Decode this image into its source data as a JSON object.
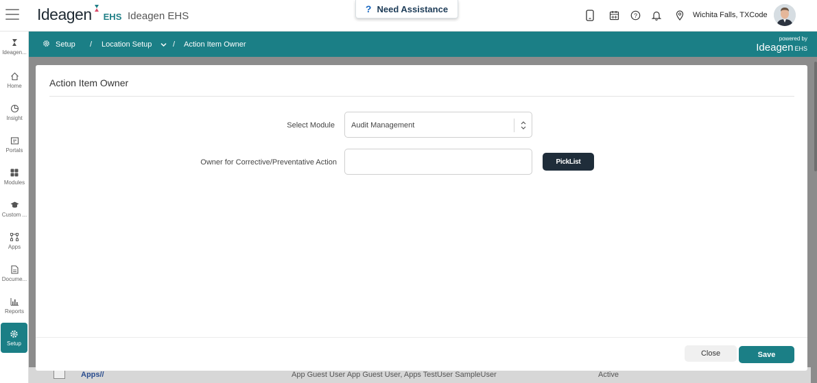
{
  "header": {
    "logo_word": "Ideagen",
    "logo_suffix": "EHS",
    "app_title": "Ideagen EHS",
    "assist_label": "Need Assistance",
    "location": "Wichita Falls, TXCode"
  },
  "sidebar": {
    "items": [
      {
        "label": "Ideagen...",
        "icon": "ideagen-icon"
      },
      {
        "label": "Home",
        "icon": "home-icon"
      },
      {
        "label": "Insight",
        "icon": "pie-chart-icon"
      },
      {
        "label": "Portals",
        "icon": "portal-icon"
      },
      {
        "label": "Modules",
        "icon": "grid-icon"
      },
      {
        "label": "Custom ...",
        "icon": "graduation-cap-icon"
      },
      {
        "label": "Apps",
        "icon": "apps-icon"
      },
      {
        "label": "Docume...",
        "icon": "document-icon"
      },
      {
        "label": "Reports",
        "icon": "bar-chart-icon"
      },
      {
        "label": "Setup",
        "icon": "gear-icon"
      }
    ]
  },
  "breadcrumb": {
    "setup": "Setup",
    "sep1": "/",
    "location_setup": "Location Setup",
    "sep2": "/",
    "current": "Action Item Owner",
    "powered_by": "powered by",
    "powered_logo": "Ideagen",
    "powered_suffix": "EHS"
  },
  "background_row": {
    "col1": "Apps//",
    "col2": "App Guest User App Guest User, Apps TestUser SampleUser",
    "col3": "Active"
  },
  "modal": {
    "title": "Action Item Owner",
    "select_module_label": "Select Module",
    "select_module_value": "Audit Management",
    "owner_label": "Owner for Corrective/Preventative Action",
    "owner_value": "",
    "picklist_label": "PickList",
    "close_label": "Close",
    "save_label": "Save"
  },
  "colors": {
    "accent": "#1b7f86",
    "dark_button": "#1f2d3a"
  }
}
